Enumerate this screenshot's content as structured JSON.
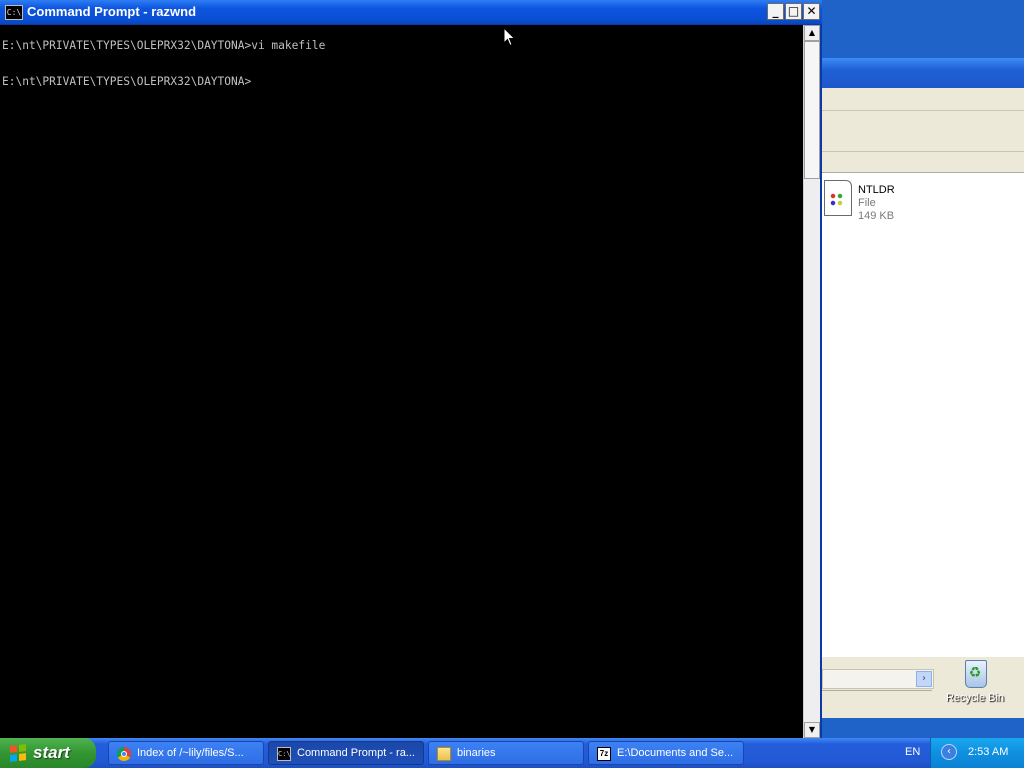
{
  "cmd_window": {
    "title": "Command Prompt - razwnd",
    "title_icon_text": "C:\\",
    "controls": {
      "minimize": "_",
      "maximize": "□",
      "close": "✕"
    },
    "console_lines": [
      "E:\\nt\\PRIVATE\\TYPES\\OLEPRX32\\DAYTONA>vi makefile",
      "",
      "E:\\nt\\PRIVATE\\TYPES\\OLEPRX32\\DAYTONA>"
    ],
    "scrollbar": {
      "up_arrow": "▲",
      "down_arrow": "▼"
    }
  },
  "explorer_window": {
    "file": {
      "name": "NTLDR",
      "type": "File",
      "size": "149 KB"
    },
    "hscroll_arrow": "›"
  },
  "desktop": {
    "recycle_bin_label": "Recycle Bin",
    "recycle_symbol": "♻"
  },
  "taskbar": {
    "start_label": "start",
    "tasks": [
      {
        "label": "Index of /~lily/files/S...",
        "icon": "chrome-icon",
        "active": false
      },
      {
        "label": "Command Prompt - ra...",
        "icon": "cmd-icon",
        "active": true
      },
      {
        "label": "binaries",
        "icon": "folder-icon",
        "active": false
      },
      {
        "label": "E:\\Documents and Se...",
        "icon": "7zip-icon",
        "active": false
      }
    ],
    "icon_text": {
      "cmd": "C:\\",
      "sevenzip": "7z"
    },
    "language": "EN",
    "tray_arrow": "‹",
    "clock": "2:53 AM"
  },
  "colors": {
    "console_bg": "#000000",
    "console_text": "#c0c0c0",
    "titlebar_blue": "#0a4fd4",
    "start_green": "#329632",
    "tray_blue": "#0f8fe0"
  }
}
